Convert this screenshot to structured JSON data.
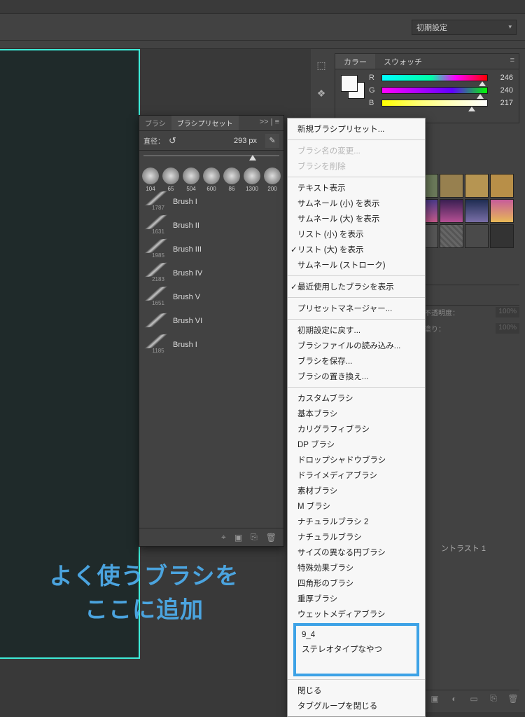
{
  "presetDropdown": "初期設定",
  "colorPanel": {
    "tab1": "カラー",
    "tab2": "スウォッチ",
    "r": {
      "label": "R",
      "value": "246"
    },
    "g": {
      "label": "G",
      "value": "240"
    },
    "b": {
      "label": "B",
      "value": "217"
    }
  },
  "layerBar": {
    "opacityLabel": "不透明度：",
    "opacityVal": "100%",
    "fillLabel": "塗り：",
    "fillVal": "100%",
    "contrastLabel": "ントラスト 1"
  },
  "brushPanel": {
    "tab1": "ブラシ",
    "tab2": "ブラシプリセット",
    "more": ">> | ≡",
    "sizeLabel": "直径：",
    "sizeVal": "293 px",
    "thumbs": [
      {
        "n": "104"
      },
      {
        "n": "65"
      },
      {
        "n": "504"
      },
      {
        "n": "600"
      },
      {
        "n": "86"
      },
      {
        "n": "1300"
      },
      {
        "n": "200"
      }
    ],
    "list": [
      {
        "num": "1787",
        "label": "Brush I"
      },
      {
        "num": "1631",
        "label": "Brush II"
      },
      {
        "num": "1985",
        "label": "Brush III"
      },
      {
        "num": "2183",
        "label": "Brush IV"
      },
      {
        "num": "1651",
        "label": "Brush V"
      },
      {
        "num": "",
        "label": "Brush VI"
      },
      {
        "num": "1185",
        "label": "Brush I"
      }
    ]
  },
  "ctx": {
    "g1": [
      "新規ブラシプリセット..."
    ],
    "g1d": [
      "ブラシ名の変更...",
      "ブラシを削除"
    ],
    "g2": [
      {
        "t": "テキスト表示",
        "c": false
      },
      {
        "t": "サムネール (小) を表示",
        "c": false
      },
      {
        "t": "サムネール (大) を表示",
        "c": false
      },
      {
        "t": "リスト (小) を表示",
        "c": false
      },
      {
        "t": "リスト (大) を表示",
        "c": true
      },
      {
        "t": "サムネール (ストローク)",
        "c": false
      }
    ],
    "g3": [
      {
        "t": "最近使用したブラシを表示",
        "c": true
      }
    ],
    "g4": [
      "プリセットマネージャー..."
    ],
    "g5": [
      "初期設定に戻す...",
      "ブラシファイルの読み込み...",
      "ブラシを保存...",
      "ブラシの置き換え..."
    ],
    "g6": [
      "カスタムブラシ",
      "基本ブラシ",
      "カリグラフィブラシ",
      "DP ブラシ",
      "ドロップシャドウブラシ",
      "ドライメディアブラシ",
      "素材ブラシ",
      "M ブラシ",
      "ナチュラルブラシ 2",
      "ナチュラルブラシ",
      "サイズの異なる円ブラシ",
      "特殊効果ブラシ",
      "四角形のブラシ",
      "重厚ブラシ",
      "ウェットメディアブラシ"
    ],
    "g7": [
      "9_4",
      "ステレオタイプなやつ"
    ],
    "g8": [
      "閉じる",
      "タブグループを閉じる"
    ]
  },
  "annotation": {
    "line1": "よく使うブラシを",
    "line2": "ここに追加"
  }
}
